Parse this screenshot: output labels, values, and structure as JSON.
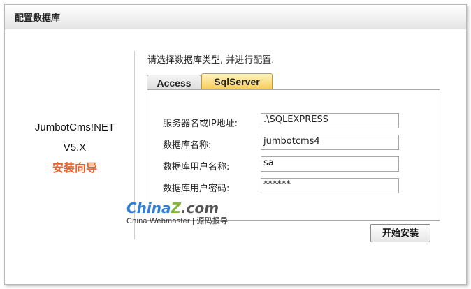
{
  "window": {
    "title": "配置数据库"
  },
  "product": {
    "name": "JumbotCms!NET",
    "version": "V5.X",
    "subtitle": "安装向导"
  },
  "instruction": "请选择数据库类型, 并进行配置.",
  "tabs": [
    {
      "label": "Access",
      "active": false
    },
    {
      "label": "SqlServer",
      "active": true
    }
  ],
  "form": {
    "server": {
      "label": "服务器名或IP地址:",
      "value": ".\\SQLEXPRESS"
    },
    "database": {
      "label": "数据库名称:",
      "value": "jumbotcms4"
    },
    "username": {
      "label": "数据库用户名称:",
      "value": "sa"
    },
    "password": {
      "label": "数据库用户密码:",
      "value": "******"
    }
  },
  "watermark": {
    "logo_part1": "China",
    "logo_part2": "Z",
    "logo_part3": ".com",
    "subtext": "China Webmaster | 源码报导"
  },
  "install_button": "开始安装",
  "colors": {
    "accent_orange": "#e8622a",
    "tab_active": "#f5c74a"
  }
}
